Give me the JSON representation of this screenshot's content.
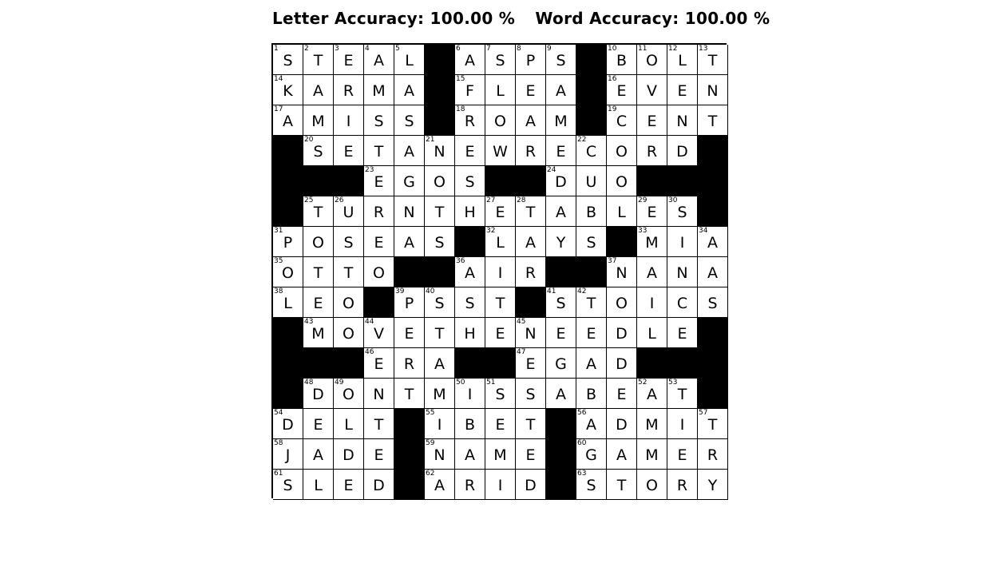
{
  "header": {
    "letter_accuracy": "Letter Accuracy: 100.00 %",
    "word_accuracy": "Word Accuracy: 100.00 %"
  },
  "grid": {
    "rows": [
      "STEAL#ASPS#BOLT",
      "KARMA#FLEA#EVEN",
      "AMISS#ROAM#CENT",
      "#SETANEWRECORD#",
      "###EGOS##DUO###",
      "#TURNTHETABLES#",
      "POSEAS#LAYS#MIA",
      "OTTO##AIR##NANA",
      "LEO#PSST#STOICS",
      "#MOVETHENEEDLE#",
      "###ERA##EGAD###",
      "#DONTMISSABEAT#",
      "DELT#IBET#ADMIT",
      "JADE#NAME#GAMER",
      "SLED#ARID#STORY"
    ],
    "numbers": [
      [
        1,
        2,
        3,
        4,
        5,
        0,
        6,
        7,
        8,
        9,
        0,
        10,
        11,
        12,
        13
      ],
      [
        14,
        0,
        0,
        0,
        0,
        0,
        15,
        0,
        0,
        0,
        0,
        16,
        0,
        0,
        0
      ],
      [
        17,
        0,
        0,
        0,
        0,
        0,
        18,
        0,
        0,
        0,
        0,
        19,
        0,
        0,
        0
      ],
      [
        0,
        20,
        0,
        0,
        0,
        21,
        0,
        0,
        0,
        0,
        22,
        0,
        0,
        0,
        0
      ],
      [
        0,
        0,
        0,
        23,
        0,
        0,
        0,
        0,
        0,
        24,
        0,
        0,
        0,
        0,
        0
      ],
      [
        0,
        25,
        26,
        0,
        0,
        0,
        0,
        27,
        28,
        0,
        0,
        0,
        29,
        30,
        0
      ],
      [
        31,
        0,
        0,
        0,
        0,
        0,
        0,
        32,
        0,
        0,
        0,
        0,
        33,
        0,
        34
      ],
      [
        35,
        0,
        0,
        0,
        0,
        0,
        36,
        0,
        0,
        0,
        0,
        37,
        0,
        0,
        0
      ],
      [
        38,
        0,
        0,
        0,
        39,
        40,
        0,
        0,
        0,
        41,
        42,
        0,
        0,
        0,
        0
      ],
      [
        0,
        43,
        0,
        44,
        0,
        0,
        0,
        0,
        45,
        0,
        0,
        0,
        0,
        0,
        0
      ],
      [
        0,
        0,
        0,
        46,
        0,
        0,
        0,
        0,
        47,
        0,
        0,
        0,
        0,
        0,
        0
      ],
      [
        0,
        48,
        49,
        0,
        0,
        0,
        50,
        51,
        0,
        0,
        0,
        0,
        52,
        53,
        0
      ],
      [
        54,
        0,
        0,
        0,
        0,
        55,
        0,
        0,
        0,
        0,
        56,
        0,
        0,
        0,
        57
      ],
      [
        58,
        0,
        0,
        0,
        0,
        59,
        0,
        0,
        0,
        0,
        60,
        0,
        0,
        0,
        0
      ],
      [
        61,
        0,
        0,
        0,
        0,
        62,
        0,
        0,
        0,
        0,
        63,
        0,
        0,
        0,
        0
      ]
    ]
  }
}
